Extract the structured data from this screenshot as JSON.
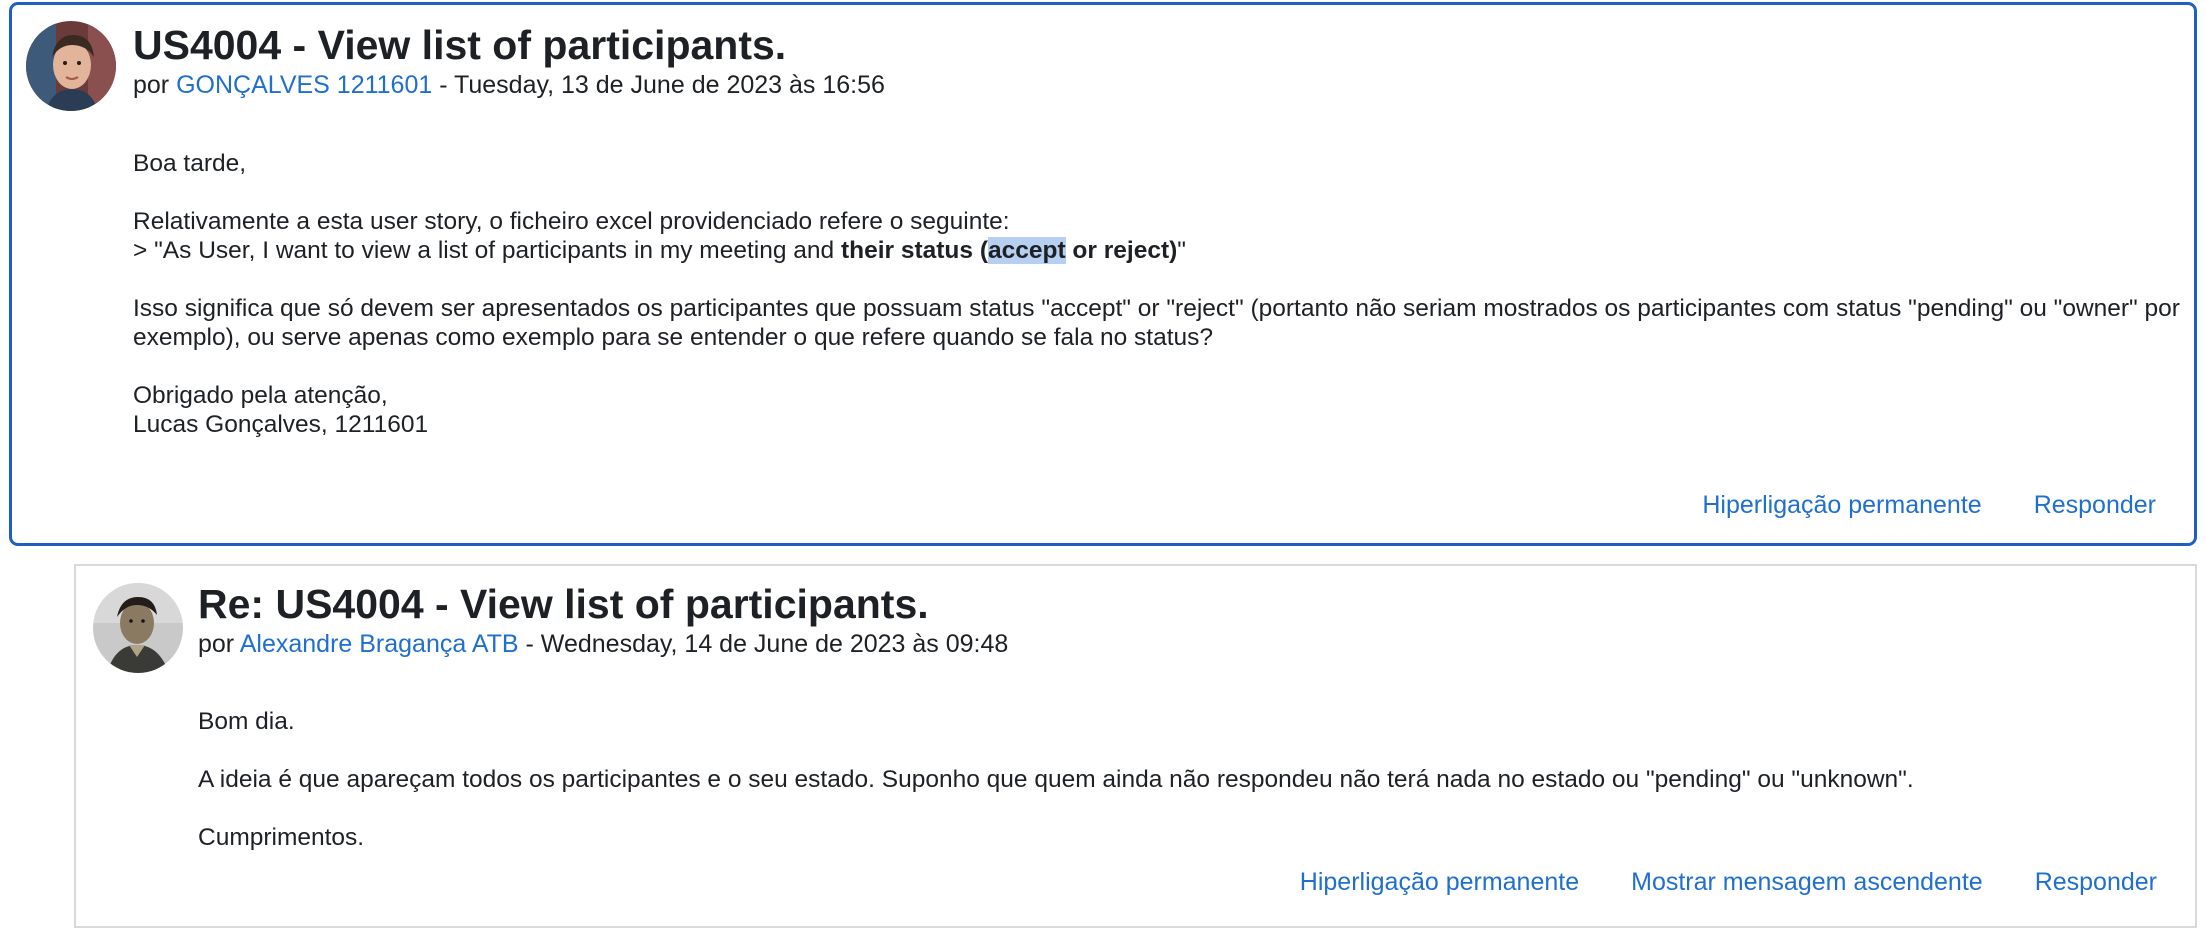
{
  "posts": [
    {
      "subject": "US4004 - View list of participants.",
      "by_prefix": "por",
      "author": "GONÇALVES 1211601",
      "date": " - Tuesday, 13 de June de 2023 às 16:56",
      "body": {
        "greeting": "Boa tarde,",
        "para1_line1": "Relativamente a esta user story, o ficheiro excel providenciado refere o seguinte:",
        "quote_plain": "> \"As User, I want to view a list of participants in my meeting and ",
        "quote_bold_a": "their status (",
        "quote_bold_hl": "accept",
        "quote_bold_b": " or reject)",
        "quote_end": "\"",
        "para2": "Isso significa que só devem ser apresentados os participantes que possuam status \"accept\" or \"reject\" (portanto não seriam mostrados os participantes com status \"pending\" ou \"owner\" por exemplo), ou serve apenas como exemplo para se entender o que refere quando se fala no status?",
        "closing": "Obrigado pela atenção,",
        "signature": "Lucas Gonçalves, 1211601"
      },
      "actions": {
        "permalink": "Hiperligação permanente",
        "reply": "Responder"
      }
    },
    {
      "subject": "Re: US4004 - View list of participants.",
      "by_prefix": "por",
      "author": "Alexandre Bragança ATB",
      "date": " - Wednesday, 14 de June de 2023 às 09:48",
      "body": {
        "greeting": "Bom dia.",
        "para1": "A ideia é que apareçam todos os participantes e o seu estado. Suponho que quem ainda não respondeu não terá nada no estado ou \"pending\" ou \"unknown\".",
        "closing": "Cumprimentos."
      },
      "actions": {
        "permalink": "Hiperligação permanente",
        "show_parent": "Mostrar mensagem ascendente",
        "reply": "Responder"
      }
    }
  ],
  "colors": {
    "link": "#1f6fd0",
    "selected_border": "#1f5fbf",
    "highlight": "#b7cff0",
    "text": "#1d2125"
  }
}
